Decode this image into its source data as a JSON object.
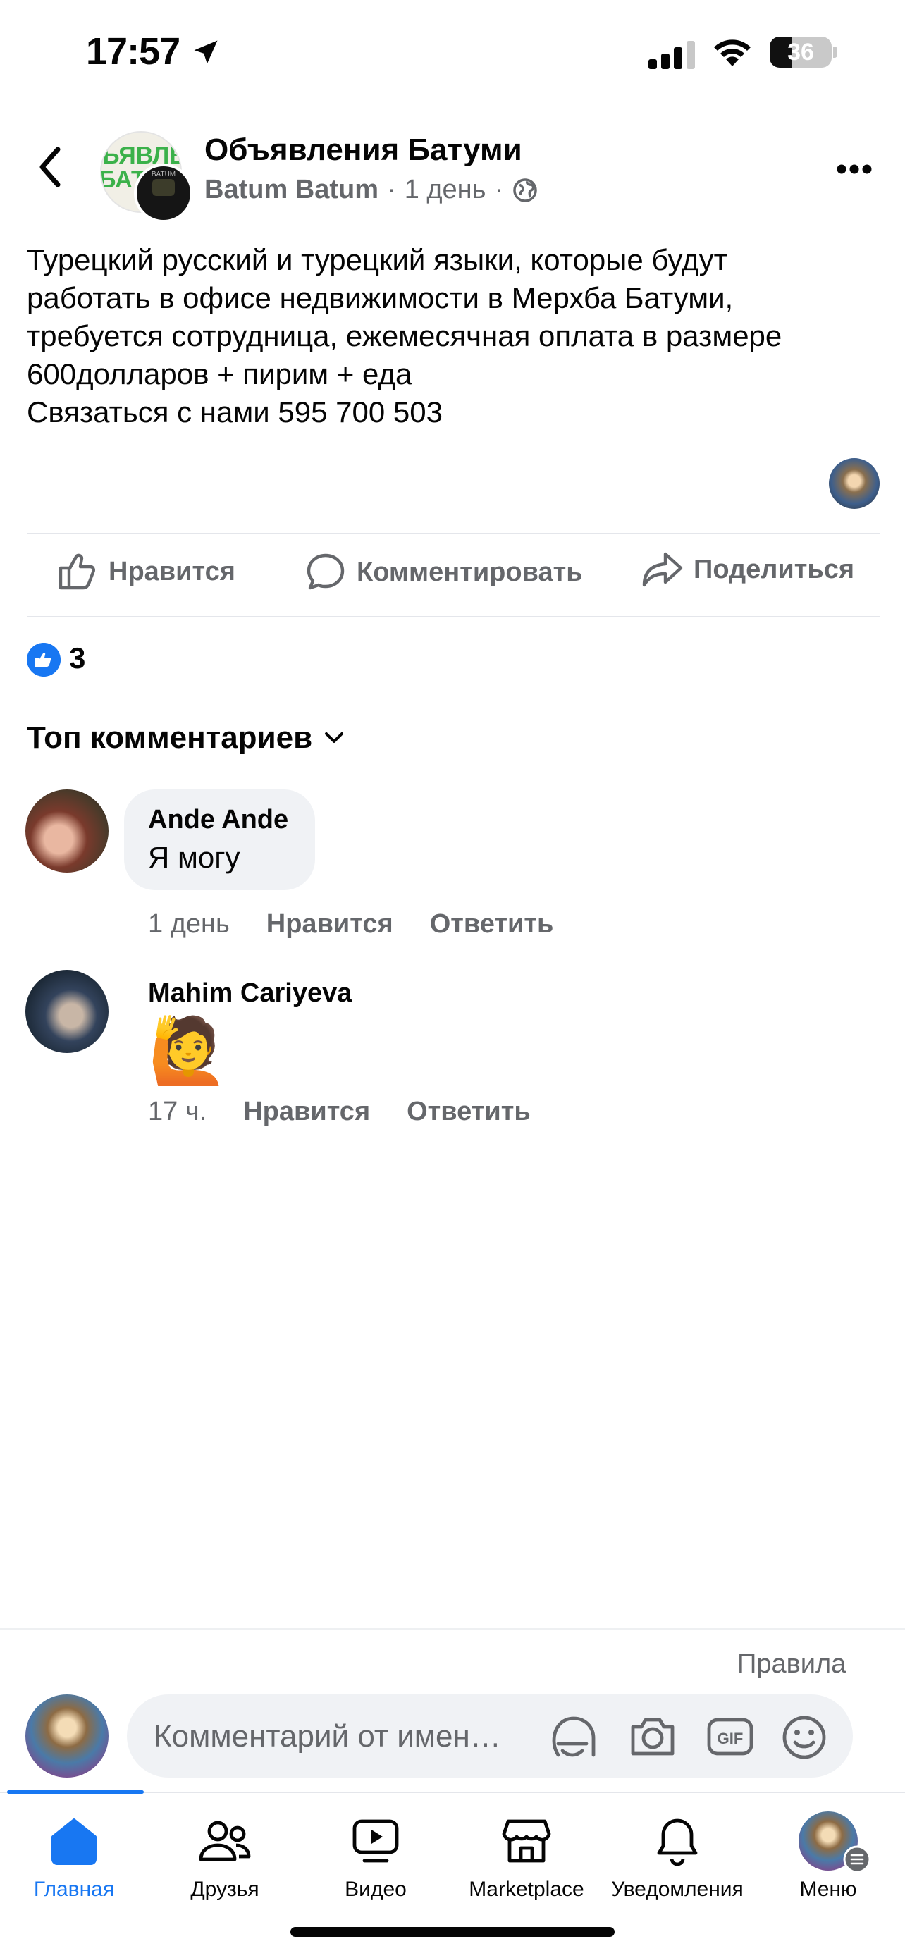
{
  "status_bar": {
    "time": "17:57",
    "battery": "36",
    "battery_fraction": 0.36
  },
  "post": {
    "group_name": "Объявления Батуми",
    "author": "Batum Batum",
    "time": "1 день",
    "text": "Турецкий русский и турецкий языки, которые будут\nработать в офисе недвижимости в Мерхба Батуми,\nтребуется сотрудница, ежемесячная оплата в размере\n600долларов + пирим + еда\nСвязаться с нами 595 700 503",
    "group_avatar_text": "ЪЯВЛЕН\nБАТ",
    "page_avatar_text": "BATUM"
  },
  "actions": {
    "like": "Нравится",
    "comment": "Комментировать",
    "share": "Поделиться"
  },
  "reactions": {
    "count": "3"
  },
  "comments_header": "Топ комментариев",
  "comments": [
    {
      "name": "Ande Ande",
      "text": "Я могу",
      "time": "1 день",
      "like": "Нравится",
      "reply": "Ответить"
    },
    {
      "name": "Mahim Cariyeva",
      "text": "🙋",
      "time": "17 ч.",
      "like": "Нравится",
      "reply": "Ответить"
    }
  ],
  "composer": {
    "rules": "Правила",
    "placeholder": "Комментарий от имен…"
  },
  "nav": [
    {
      "label": "Главная",
      "icon": "home-icon",
      "active": true
    },
    {
      "label": "Друзья",
      "icon": "friends-icon"
    },
    {
      "label": "Видео",
      "icon": "video-icon"
    },
    {
      "label": "Marketplace",
      "icon": "marketplace-icon"
    },
    {
      "label": "Уведомления",
      "icon": "bell-icon"
    },
    {
      "label": "Меню",
      "icon": "menu-avatar"
    }
  ],
  "colors": {
    "accent": "#1877f2",
    "secondary_text": "#65676b",
    "bubble": "#f0f2f5"
  }
}
